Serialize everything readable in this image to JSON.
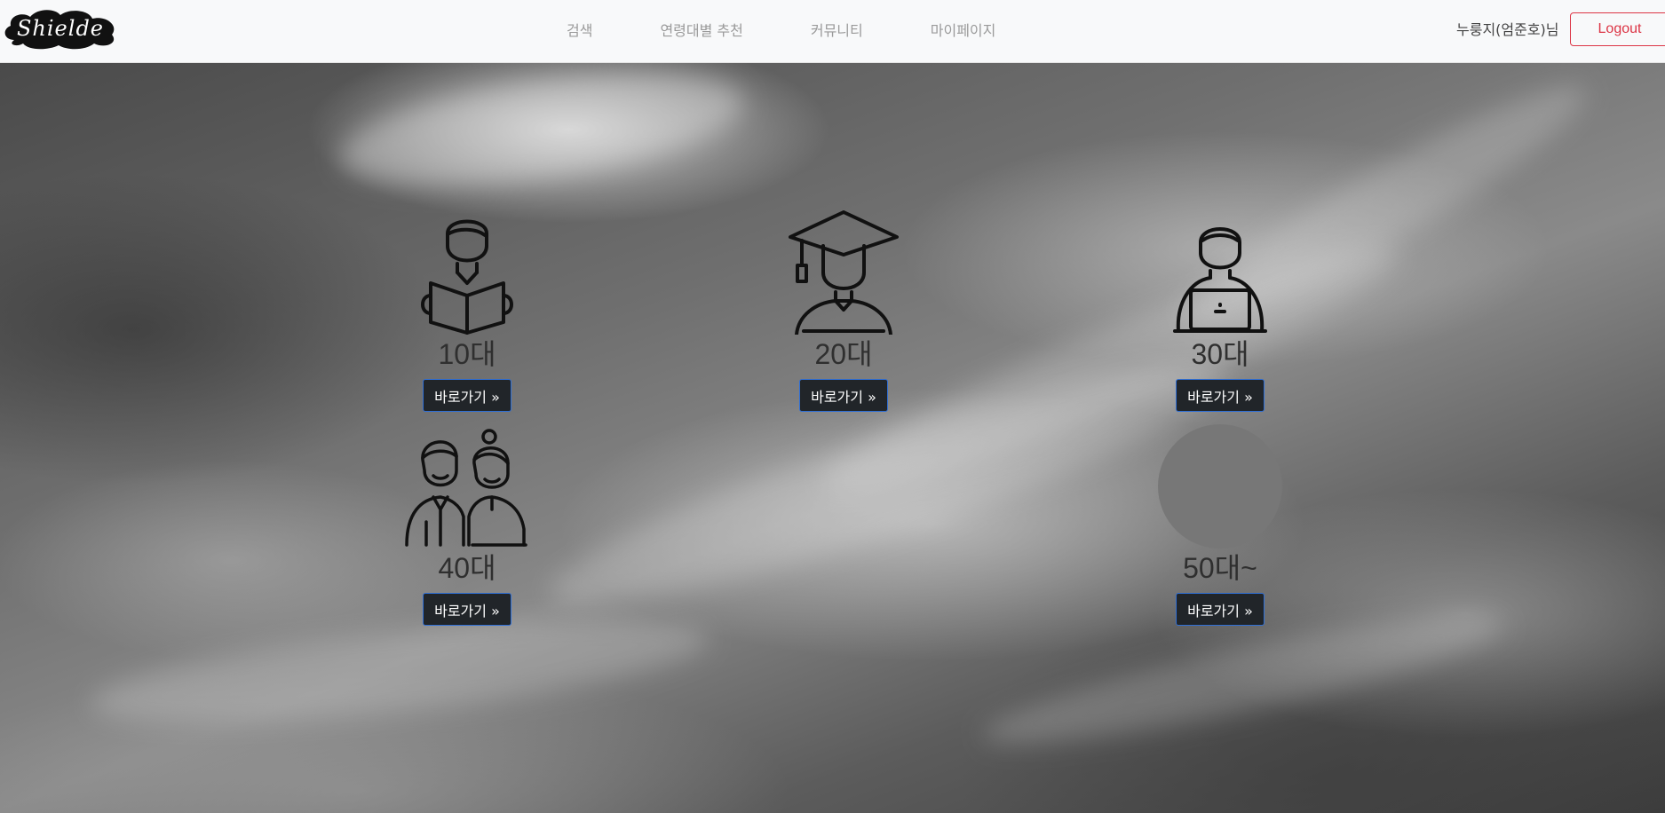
{
  "header": {
    "logo_text": "Shielde",
    "nav": [
      {
        "label": "검색"
      },
      {
        "label": "연령대별 추천"
      },
      {
        "label": "커뮤니티"
      },
      {
        "label": "마이페이지"
      }
    ],
    "user_name": "누룽지(엄준호)님",
    "logout_label": "Logout"
  },
  "ages": [
    {
      "label": "10대",
      "button": "바로가기 »",
      "icon": "student-reading-icon"
    },
    {
      "label": "20대",
      "button": "바로가기 »",
      "icon": "graduate-icon"
    },
    {
      "label": "30대",
      "button": "바로가기 »",
      "icon": "office-worker-laptop-icon"
    },
    {
      "label": "40대",
      "button": "바로가기 »",
      "icon": "couple-icon"
    },
    {
      "label": "50대~",
      "button": "바로가기 »",
      "icon": "placeholder-image"
    }
  ],
  "colors": {
    "navbar_bg": "#f8f9fa",
    "logout_red": "#dc3545",
    "button_dark": "#212529",
    "button_border": "#2f6fd6"
  }
}
